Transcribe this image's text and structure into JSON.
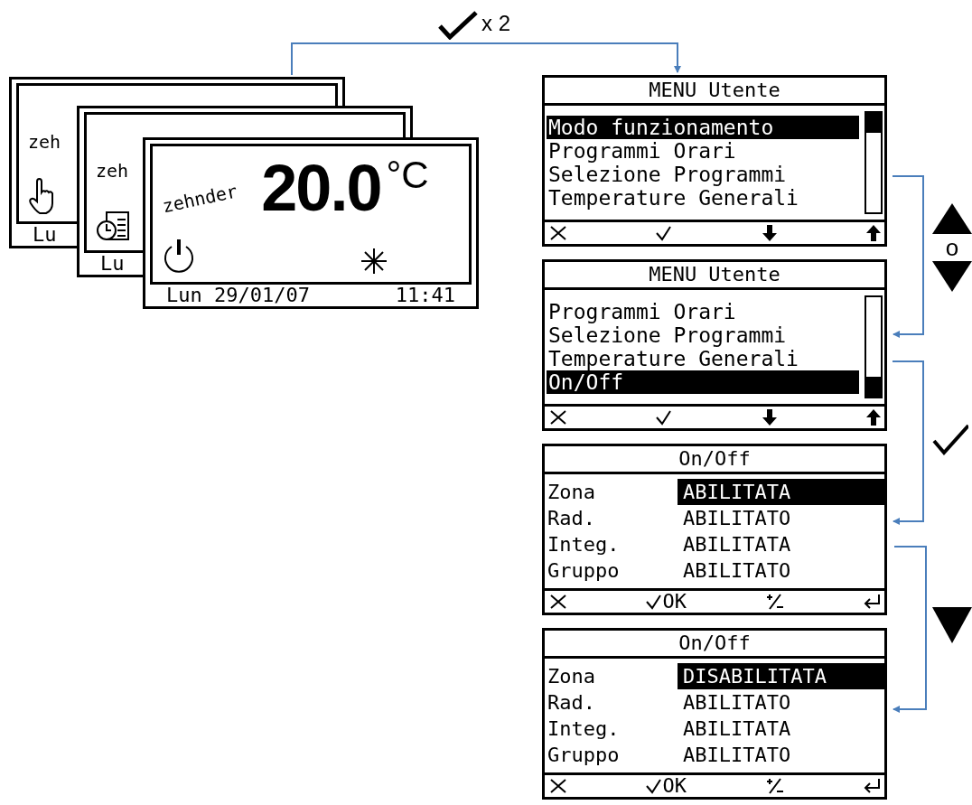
{
  "instruction": {
    "label": "x 2"
  },
  "home_screens": [
    {
      "kind": "manual",
      "logo": "zeh",
      "date": "Lu"
    },
    {
      "kind": "schedule",
      "logo": "zeh",
      "date": "Lu"
    },
    {
      "kind": "full",
      "logo": "zehnder",
      "temperature": "20.0",
      "unit": "°C",
      "date": "Lun 29/01/07",
      "time": "11:41"
    }
  ],
  "menu_screens": [
    {
      "title": "MENU Utente",
      "items": [
        {
          "label": "Modo funzionamento",
          "selected": true
        },
        {
          "label": "Programmi Orari",
          "selected": false
        },
        {
          "label": "Selezione Programmi",
          "selected": false
        },
        {
          "label": "Temperature Generali",
          "selected": false
        }
      ],
      "softkeys": [
        {
          "kind": "cancel"
        },
        {
          "kind": "confirm"
        },
        {
          "kind": "down"
        },
        {
          "kind": "up"
        }
      ]
    },
    {
      "title": "MENU Utente",
      "items": [
        {
          "label": "Programmi Orari",
          "selected": false
        },
        {
          "label": "Selezione Programmi",
          "selected": false
        },
        {
          "label": "Temperature Generali",
          "selected": false
        },
        {
          "label": "On/Off",
          "selected": true
        }
      ],
      "softkeys": [
        {
          "kind": "cancel"
        },
        {
          "kind": "confirm"
        },
        {
          "kind": "down"
        },
        {
          "kind": "up"
        }
      ]
    }
  ],
  "setting_screens": [
    {
      "title": "On/Off",
      "rows": [
        {
          "label": "Zona",
          "value": "ABILITATA",
          "selected": true
        },
        {
          "label": "Rad.",
          "value": "ABILITATO",
          "selected": false
        },
        {
          "label": "Integ.",
          "value": "ABILITATA",
          "selected": false
        },
        {
          "label": "Gruppo",
          "value": "ABILITATO",
          "selected": false
        }
      ],
      "softkeys": [
        {
          "kind": "cancel"
        },
        {
          "kind": "confirm",
          "label": "OK"
        },
        {
          "kind": "plusminus"
        },
        {
          "kind": "enter"
        }
      ]
    },
    {
      "title": "On/Off",
      "rows": [
        {
          "label": "Zona",
          "value": "DISABILITATA",
          "selected": true
        },
        {
          "label": "Rad.",
          "value": "ABILITATO",
          "selected": false
        },
        {
          "label": "Integ.",
          "value": "ABILITATA",
          "selected": false
        },
        {
          "label": "Gruppo",
          "value": "ABILITATO",
          "selected": false
        }
      ],
      "softkeys": [
        {
          "kind": "cancel"
        },
        {
          "kind": "confirm",
          "label": "OK"
        },
        {
          "kind": "plusminus"
        },
        {
          "kind": "enter"
        }
      ]
    }
  ],
  "legend": [
    {
      "kind": "updown",
      "label": "o"
    },
    {
      "kind": "confirm"
    },
    {
      "kind": "down"
    }
  ]
}
